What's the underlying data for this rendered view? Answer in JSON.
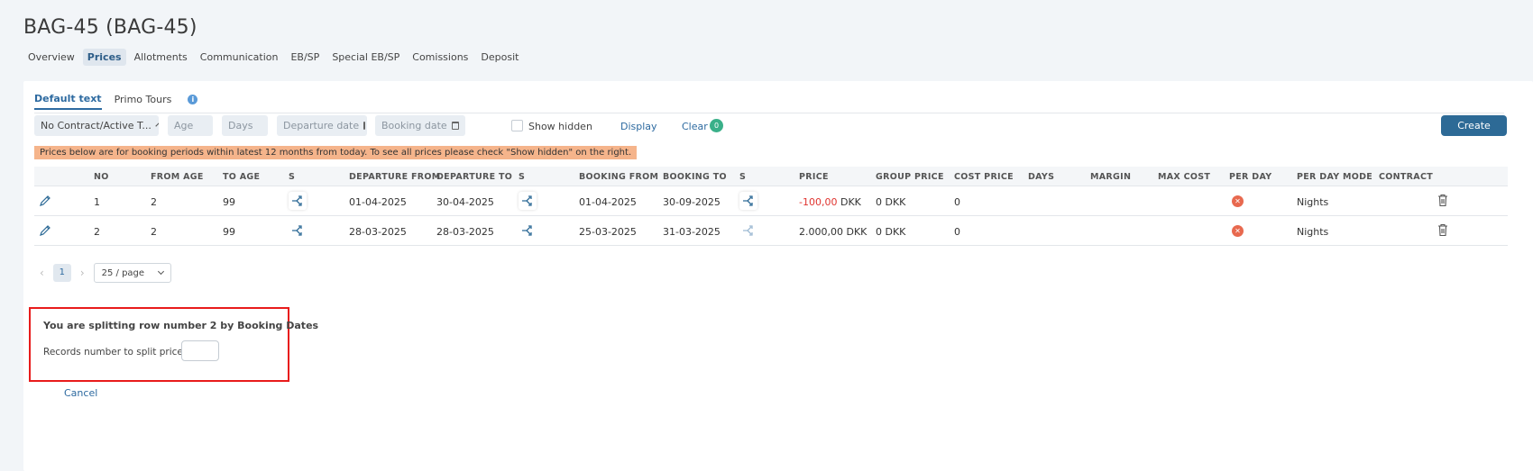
{
  "page": {
    "title": "BAG-45 (BAG-45)"
  },
  "tabs": [
    "Overview",
    "Prices",
    "Allotments",
    "Communication",
    "EB/SP",
    "Special EB/SP",
    "Comissions",
    "Deposit"
  ],
  "active_tab": "Prices",
  "subtabs": {
    "default": "Default text",
    "primo": "Primo Tours"
  },
  "filters": {
    "contract": "No Contract/Active T...",
    "age_placeholder": "Age",
    "days_placeholder": "Days",
    "departure_placeholder": "Departure date",
    "booking_placeholder": "Booking date",
    "show_hidden": "Show hidden",
    "display": "Display",
    "clear": "Clear",
    "clear_count": "0",
    "create": "Create"
  },
  "notice": "Prices below are for booking periods within latest 12 months from today. To see all prices please check \"Show hidden\" on the right.",
  "table": {
    "headers": [
      "NO",
      "FROM AGE",
      "TO AGE",
      "S",
      "DEPARTURE FROM",
      "DEPARTURE TO",
      "S",
      "BOOKING FROM",
      "BOOKING TO",
      "S",
      "PRICE",
      "GROUP PRICE",
      "COST PRICE",
      "DAYS",
      "MARGIN",
      "MAX COST",
      "PER DAY",
      "PER DAY MODE",
      "CONTRACT"
    ],
    "rows": [
      {
        "no": "1",
        "from_age": "2",
        "to_age": "99",
        "dep_from": "01-04-2025",
        "dep_to": "30-04-2025",
        "book_from": "01-04-2025",
        "book_to": "30-09-2025",
        "price_value": "-100,00",
        "price_currency": "DKK",
        "group_price": "0 DKK",
        "cost_price": "0",
        "per_day_mode": "Nights"
      },
      {
        "no": "2",
        "from_age": "2",
        "to_age": "99",
        "dep_from": "28-03-2025",
        "dep_to": "28-03-2025",
        "book_from": "25-03-2025",
        "book_to": "31-03-2025",
        "price_value": "2.000,00",
        "price_currency": "DKK",
        "group_price": "0 DKK",
        "cost_price": "0",
        "per_day_mode": "Nights"
      }
    ]
  },
  "pagination": {
    "current": "1",
    "page_size": "25 / page"
  },
  "split": {
    "title": "You are splitting row number 2 by Booking Dates",
    "label": "Records number to split prices in",
    "cancel": "Cancel"
  },
  "colors": {
    "accent": "#2d6a96",
    "highlight": "#e81b1b",
    "notice_bg": "#f5b48b"
  }
}
